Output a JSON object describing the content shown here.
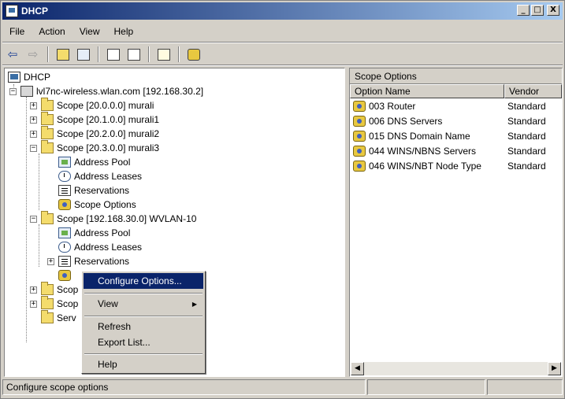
{
  "window": {
    "title": "DHCP",
    "minimize": "_",
    "maximize": "□",
    "close": "X"
  },
  "menu": {
    "file": "File",
    "action": "Action",
    "view": "View",
    "help": "Help"
  },
  "toolbar": {
    "back": "⇦",
    "forward": "⇨"
  },
  "tree": {
    "root": "DHCP",
    "server": "lvl7nc-wireless.wlan.com [192.168.30.2]",
    "scope0": "Scope [20.0.0.0] murali",
    "scope1": "Scope [20.1.0.0] murali1",
    "scope2": "Scope [20.2.0.0] murali2",
    "scope3": "Scope [20.3.0.0] murali3",
    "s3_pool": "Address Pool",
    "s3_leases": "Address Leases",
    "s3_res": "Reservations",
    "s3_opts": "Scope Options",
    "scope4": "Scope [192.168.30.0] WVLAN-10",
    "s4_pool": "Address Pool",
    "s4_leases": "Address Leases",
    "s4_res": "Reservations",
    "scope5": "Scop",
    "scope6": "Scop",
    "server_opts": "Serv"
  },
  "right_pane": {
    "title": "Scope Options",
    "col_name": "Option Name",
    "col_vendor": "Vendor",
    "rows": [
      {
        "name": "003 Router",
        "vendor": "Standard"
      },
      {
        "name": "006 DNS Servers",
        "vendor": "Standard"
      },
      {
        "name": "015 DNS Domain Name",
        "vendor": "Standard"
      },
      {
        "name": "044 WINS/NBNS Servers",
        "vendor": "Standard"
      },
      {
        "name": "046 WINS/NBT Node Type",
        "vendor": "Standard"
      }
    ]
  },
  "context_menu": {
    "configure": "Configure Options...",
    "view": "View",
    "refresh": "Refresh",
    "export": "Export List...",
    "help": "Help"
  },
  "status": {
    "text": "Configure scope options"
  }
}
